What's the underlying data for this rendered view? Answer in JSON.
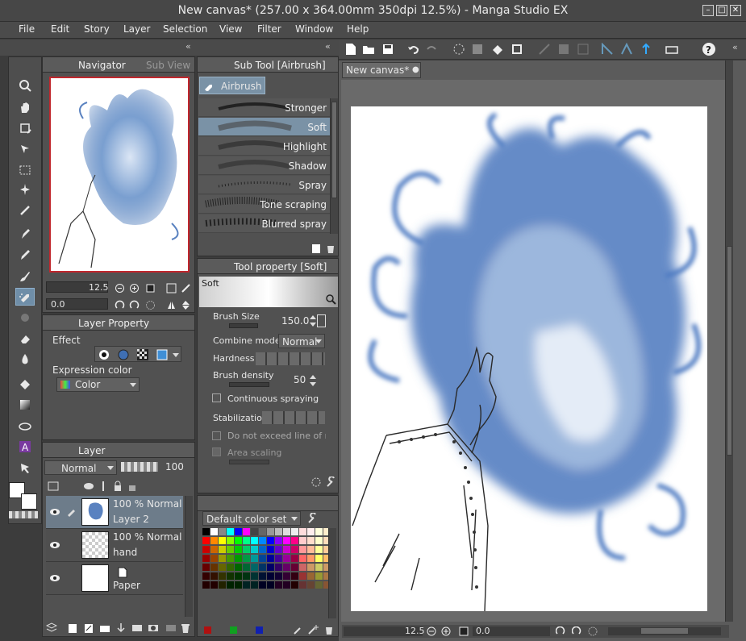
{
  "window": {
    "title": "New canvas* (257.00 x 364.00mm 350dpi 12.5%)  - Manga Studio EX"
  },
  "menu": [
    "File",
    "Edit",
    "Story",
    "Layer",
    "Selection",
    "View",
    "Filter",
    "Window",
    "Help"
  ],
  "navigator": {
    "tab_navigator": "Navigator",
    "tab_subview": "Sub View",
    "zoom": "12.5",
    "angle": "0.0"
  },
  "layer_property": {
    "tab": "Layer Property",
    "effect_label": "Effect",
    "expression_label": "Expression color",
    "expression_value": "Color"
  },
  "layer_panel": {
    "tab": "Layer",
    "blend": "Normal",
    "opacity": "100",
    "layers": [
      {
        "opacity": "100 %",
        "blend": "Normal",
        "name": "Layer 2"
      },
      {
        "opacity": "100 %",
        "blend": "Normal",
        "name": "hand"
      },
      {
        "opacity": "",
        "blend": "",
        "name": "Paper"
      }
    ]
  },
  "subtool": {
    "tab": "Sub Tool [Airbrush]",
    "group": "Airbrush",
    "brushes": [
      "Stronger",
      "Soft",
      "Highlight",
      "Shadow",
      "Spray",
      "Tone scraping",
      "Blurred spray"
    ]
  },
  "tool_property": {
    "tab": "Tool property [Soft]",
    "preview_label": "Soft",
    "brush_size_label": "Brush Size",
    "brush_size": "150.0",
    "combine_label": "Combine mode",
    "combine_value": "Normal",
    "hardness_label": "Hardness",
    "density_label": "Brush density",
    "density": "50",
    "continuous_label": "Continuous spraying",
    "stabilization_label": "Stabilization",
    "exceed_label": "Do not exceed line of ref",
    "area_label": "Area scaling"
  },
  "color_set": {
    "name": "Default color set"
  },
  "canvas": {
    "tab": "New canvas*",
    "zoom": "12.5",
    "angle": "0.0"
  },
  "colors": {
    "accent": "#6f8ea8",
    "flame": "#3f6fb3",
    "panel": "#515151"
  }
}
